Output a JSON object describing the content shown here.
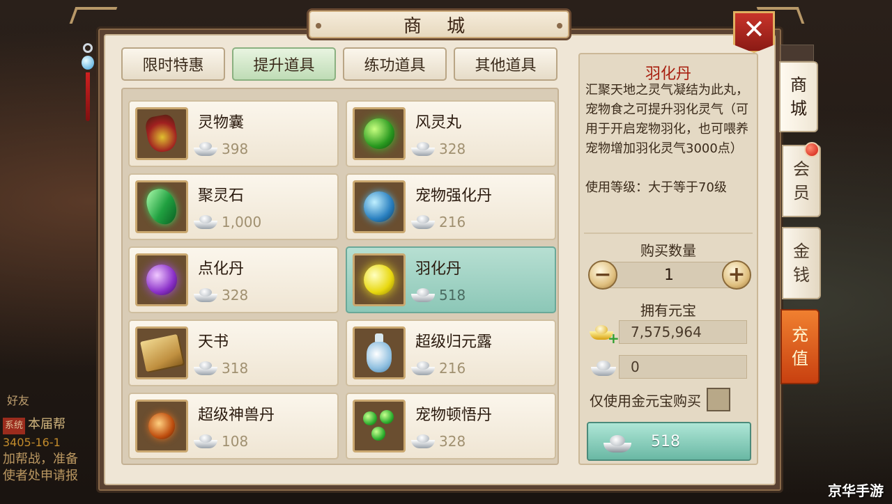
{
  "window": {
    "title": "商 城"
  },
  "tabs": [
    {
      "label": "限时特惠",
      "active": false
    },
    {
      "label": "提升道具",
      "active": true
    },
    {
      "label": "练功道具",
      "active": false
    },
    {
      "label": "其他道具",
      "active": false
    }
  ],
  "items": [
    {
      "name": "灵物囊",
      "price": "398",
      "icon": "pouch-icon",
      "selected": false
    },
    {
      "name": "风灵丸",
      "price": "328",
      "icon": "green-pill-icon",
      "selected": false
    },
    {
      "name": "聚灵石",
      "price": "1,000",
      "icon": "green-gem-icon",
      "selected": false
    },
    {
      "name": "宠物强化丹",
      "price": "216",
      "icon": "blue-orb-icon",
      "selected": false
    },
    {
      "name": "点化丹",
      "price": "328",
      "icon": "purple-orb-icon",
      "selected": false
    },
    {
      "name": "羽化丹",
      "price": "518",
      "icon": "yellow-orb-icon",
      "selected": true
    },
    {
      "name": "天书",
      "price": "318",
      "icon": "book-icon",
      "selected": false
    },
    {
      "name": "超级归元露",
      "price": "216",
      "icon": "bottle-icon",
      "selected": false
    },
    {
      "name": "超级神兽丹",
      "price": "108",
      "icon": "fire-orb-icon",
      "selected": false
    },
    {
      "name": "宠物顿悟丹",
      "price": "328",
      "icon": "green-beads-icon",
      "selected": false
    }
  ],
  "detail": {
    "title": "羽化丹",
    "description": "汇聚天地之灵气凝结为此丸，宠物食之可提升羽化灵气（可用于开启宠物羽化，也可喂养宠物增加羽化灵气3000点）",
    "level": "使用等级：大于等于70级",
    "quantity_label": "购买数量",
    "quantity": "1",
    "own_label": "拥有元宝",
    "gold_balance": "7,575,964",
    "silver_balance": "0",
    "gold_only_label": "仅使用金元宝购买",
    "buy_price": "518"
  },
  "side_tabs": [
    {
      "label": [
        "商",
        "城"
      ],
      "active": true
    },
    {
      "label": [
        "会",
        "员"
      ],
      "active": false
    },
    {
      "label": [
        "金",
        "钱"
      ],
      "active": false
    },
    {
      "label": [
        "充",
        "值"
      ],
      "active": false
    }
  ],
  "background": {
    "friend_label": "好友",
    "chat_tag": "系统",
    "chat_line1": "本届帮",
    "chat_line2": "3405-16-1",
    "chat_line3": "加帮战，准备",
    "chat_line4": "使者处申请报"
  },
  "watermark": "京华手游",
  "colors": {
    "accent_red": "#a82010",
    "selected_teal": "#8cc7b7",
    "active_tab_green": "#bfdcb6",
    "recharge_orange": "#e06020"
  }
}
